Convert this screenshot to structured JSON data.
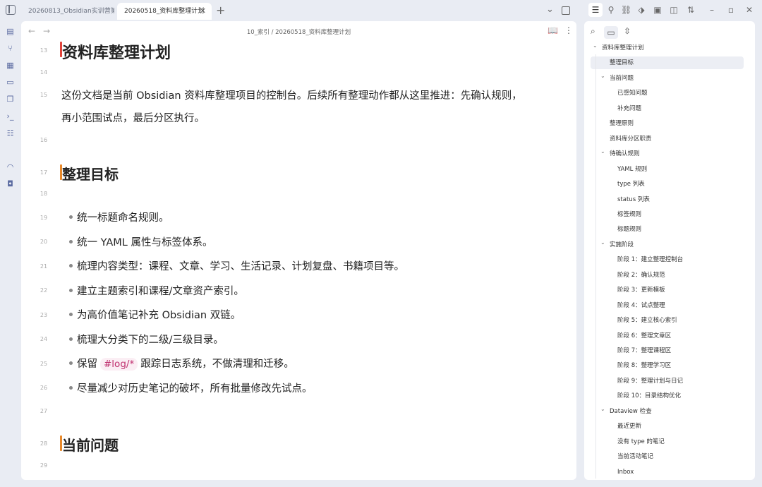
{
  "tabs": [
    {
      "label": "20260813_Obsidian实训营第…",
      "active": false
    },
    {
      "label": "20260518_资料库整理计划",
      "active": true
    }
  ],
  "breadcrumb": "10_索引 / 20260518_资料库整理计划",
  "title": "资料库整理计划",
  "editor_lines": {
    "l13": "13",
    "l14": "14",
    "l15": "15",
    "l16": "16",
    "l17": "17",
    "l18": "18",
    "l19": "19",
    "l20": "20",
    "l21": "21",
    "l22": "22",
    "l23": "23",
    "l24": "24",
    "l25": "25",
    "l26": "26",
    "l27": "27",
    "l28": "28",
    "l29": "29"
  },
  "intro_line1": "这份文档是当前 Obsidian 资料库整理项目的控制台。后续所有整理动作都从这里推进：先确认规则，",
  "intro_line2": "再小范围试点，最后分区执行。",
  "section_goals": "整理目标",
  "goals": [
    "统一标题命名规则。",
    "统一 YAML 属性与标签体系。",
    "梳理内容类型：课程、文章、学习、生活记录、计划复盘、书籍项目等。",
    "建立主题索引和课程/文章资产索引。",
    "为高价值笔记补充 Obsidian 双链。",
    "梳理大分类下的二级/三级目录。",
    "保留",
    "尽量减少对历史笔记的破坏，所有批量修改先试点。"
  ],
  "goal7_tag": "#log/*",
  "goal7_rest": "跟踪日志系统，不做清理和迁移。",
  "section_issues": "当前问题",
  "colors": {
    "accent_red": "#e0433a",
    "accent_orange": "#e8892b",
    "tag_color": "#c0306f"
  },
  "outline": {
    "root": "资料库整理计划",
    "items": [
      {
        "label": "整理目标",
        "level": 1
      },
      {
        "label": "当前问题",
        "level": 1
      },
      {
        "label": "已感知问题",
        "level": 2
      },
      {
        "label": "补充问题",
        "level": 2
      },
      {
        "label": "整理原则",
        "level": 1
      },
      {
        "label": "资料库分区职责",
        "level": 1
      },
      {
        "label": "待确认规则",
        "level": 1
      },
      {
        "label": "YAML 规则",
        "level": 2
      },
      {
        "label": "type 列表",
        "level": 2
      },
      {
        "label": "status 列表",
        "level": 2
      },
      {
        "label": "标签规则",
        "level": 2
      },
      {
        "label": "标题规则",
        "level": 2
      },
      {
        "label": "实施阶段",
        "level": 1
      },
      {
        "label": "阶段 1：建立整理控制台",
        "level": 2
      },
      {
        "label": "阶段 2：确认规范",
        "level": 2
      },
      {
        "label": "阶段 3：更新模板",
        "level": 2
      },
      {
        "label": "阶段 4：试点整理",
        "level": 2
      },
      {
        "label": "阶段 5：建立核心索引",
        "level": 2
      },
      {
        "label": "阶段 6：整理文章区",
        "level": 2
      },
      {
        "label": "阶段 7：整理课程区",
        "level": 2
      },
      {
        "label": "阶段 8：整理学习区",
        "level": 2
      },
      {
        "label": "阶段 9：整理计划与日记",
        "level": 2
      },
      {
        "label": "阶段 10：目录结构优化",
        "level": 2
      },
      {
        "label": "Dataview 检查",
        "level": 1
      },
      {
        "label": "最近更新",
        "level": 2
      },
      {
        "label": "没有 type 的笔记",
        "level": 2
      },
      {
        "label": "当前活动笔记",
        "level": 2
      },
      {
        "label": "Inbox",
        "level": 2
      }
    ]
  }
}
